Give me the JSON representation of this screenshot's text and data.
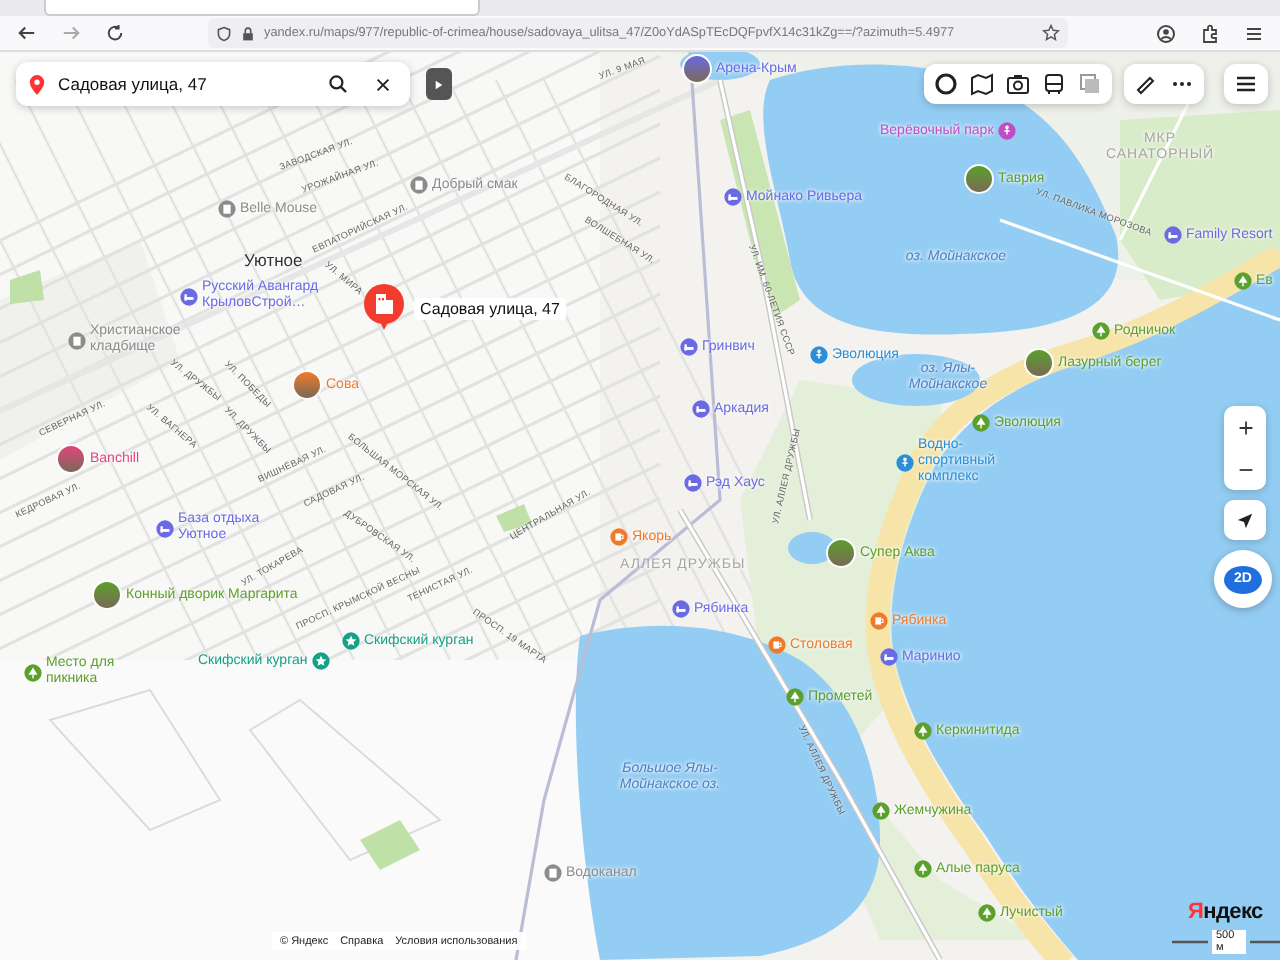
{
  "browser": {
    "url": "yandex.ru/maps/977/republic-of-crimea/house/sadovaya_ulitsa_47/Z0oYdASpTEcDQFpvfX14c31kZg==/?azimuth=5.4977"
  },
  "search": {
    "value": "Садовая улица, 47"
  },
  "selected_place": {
    "label": "Садовая улица, 47"
  },
  "places": [
    {
      "label": "Арена-Крым",
      "kind": "hotel",
      "photo": true
    },
    {
      "label": "Верёвочный парк",
      "kind": "fun",
      "photo": false
    },
    {
      "label": "МКР САНАТОРНЫЙ",
      "kind": "area"
    },
    {
      "label": "Таврия",
      "kind": "park",
      "photo": true
    },
    {
      "label": "Добрый смак",
      "kind": "public",
      "photo": false
    },
    {
      "label": "Мойнако Ривьера",
      "kind": "hotel",
      "photo": false
    },
    {
      "label": "Belle Mouse",
      "kind": "public",
      "photo": false
    },
    {
      "label": "Family Resort",
      "kind": "hotel",
      "photo": false
    },
    {
      "label": "оз. Мойнакское",
      "kind": "water"
    },
    {
      "label": "Уютное",
      "kind": "town"
    },
    {
      "label": "Ев",
      "kind": "park",
      "photo": false
    },
    {
      "label": "Русский Авангард КрыловСтрой…",
      "kind": "hotel",
      "photo": false
    },
    {
      "label": "Родничок",
      "kind": "park",
      "photo": false
    },
    {
      "label": "Христианское кладбище",
      "kind": "public",
      "photo": false
    },
    {
      "label": "Гринвич",
      "kind": "hotel",
      "photo": false
    },
    {
      "label": "Эволюция",
      "kind": "sport",
      "photo": false
    },
    {
      "label": "Лазурный берег",
      "kind": "park",
      "photo": true
    },
    {
      "label": "Сова",
      "kind": "food",
      "photo": true
    },
    {
      "label": "оз. Ялы-Мойнакское",
      "kind": "water"
    },
    {
      "label": "Аркадия",
      "kind": "hotel",
      "photo": false
    },
    {
      "label": "Эволюция",
      "kind": "park",
      "photo": false
    },
    {
      "label": "Banchill",
      "kind": "shop",
      "photo": true
    },
    {
      "label": "Водно-спортивный комплекс",
      "kind": "sport",
      "photo": false
    },
    {
      "label": "Рэд Хаус",
      "kind": "hotel",
      "photo": false
    },
    {
      "label": "База отдыха Уютное",
      "kind": "hotel",
      "photo": false
    },
    {
      "label": "Якорь",
      "kind": "food",
      "photo": false
    },
    {
      "label": "Супер Аква",
      "kind": "park",
      "photo": true
    },
    {
      "label": "АЛЛЕЯ ДРУЖБЫ",
      "kind": "area"
    },
    {
      "label": "Конный дворик Маргарита",
      "kind": "park",
      "photo": true
    },
    {
      "label": "Рябинка",
      "kind": "hotel",
      "photo": false
    },
    {
      "label": "Рябинка",
      "kind": "food",
      "photo": false
    },
    {
      "label": "Скифский курган",
      "kind": "sight",
      "photo": false
    },
    {
      "label": "Столовая",
      "kind": "food",
      "photo": false
    },
    {
      "label": "Маринио",
      "kind": "hotel",
      "photo": false
    },
    {
      "label": "Место для пикника",
      "kind": "park",
      "photo": false
    },
    {
      "label": "Скифский курган",
      "kind": "sight",
      "photo": false
    },
    {
      "label": "Прометей",
      "kind": "park",
      "photo": false
    },
    {
      "label": "Керкинитида",
      "kind": "park",
      "photo": false
    },
    {
      "label": "Большое Ялы-Мойнакское оз.",
      "kind": "water"
    },
    {
      "label": "Жемчужина",
      "kind": "park",
      "photo": false
    },
    {
      "label": "Алые паруса",
      "kind": "park",
      "photo": false
    },
    {
      "label": "Водоканал",
      "kind": "public",
      "photo": false
    },
    {
      "label": "Лучистый",
      "kind": "park",
      "photo": false
    }
  ],
  "streets": [
    "ЗАВОДСКАЯ УЛ.",
    "УРОЖАЙНАЯ УЛ.",
    "ЕВПАТОРИЙСКАЯ УЛ.",
    "УЛ. МИРА",
    "БЛАГОРОДНАЯ УЛ.",
    "ВОЛШЕБНАЯ УЛ.",
    "УЛ. ДРУЖБЫ",
    "УЛ. ПОБЕДЫ",
    "УЛ. ДРУЖБЫ",
    "СЕВЕРНАЯ УЛ.",
    "УЛ. ВАГНЕРА",
    "ВИШНЁВАЯ УЛ.",
    "БОЛЬШАЯ МОРСКАЯ УЛ.",
    "КЕДРОВАЯ УЛ.",
    "САДОВАЯ УЛ.",
    "УЛ. ТОКАРЕВА",
    "ДУБРОВСКАЯ УЛ.",
    "ТЕНИСТАЯ УЛ.",
    "ПРОСП. 19 МАРТА",
    "ПРОСП. КРЫМСКОЙ ВЕСНЫ",
    "ЦЕНТРАЛЬНАЯ УЛ.",
    "УЛ. ИМ. 60-ЛЕТИЯ СССР",
    "УЛ. АЛЛЕЯ ДРУЖБЫ",
    "УЛ. АЛЛЕЯ ДРУЖБЫ",
    "УЛ. ПАВЛИКА МОРОЗОВА",
    "УЛ. 9 МАЯ"
  ],
  "view_mode": {
    "label": "2D"
  },
  "footer": {
    "links": [
      "© Яндекс",
      "Справка",
      "Условия использования"
    ],
    "scale": "500 м",
    "logo": "Яндекс"
  }
}
